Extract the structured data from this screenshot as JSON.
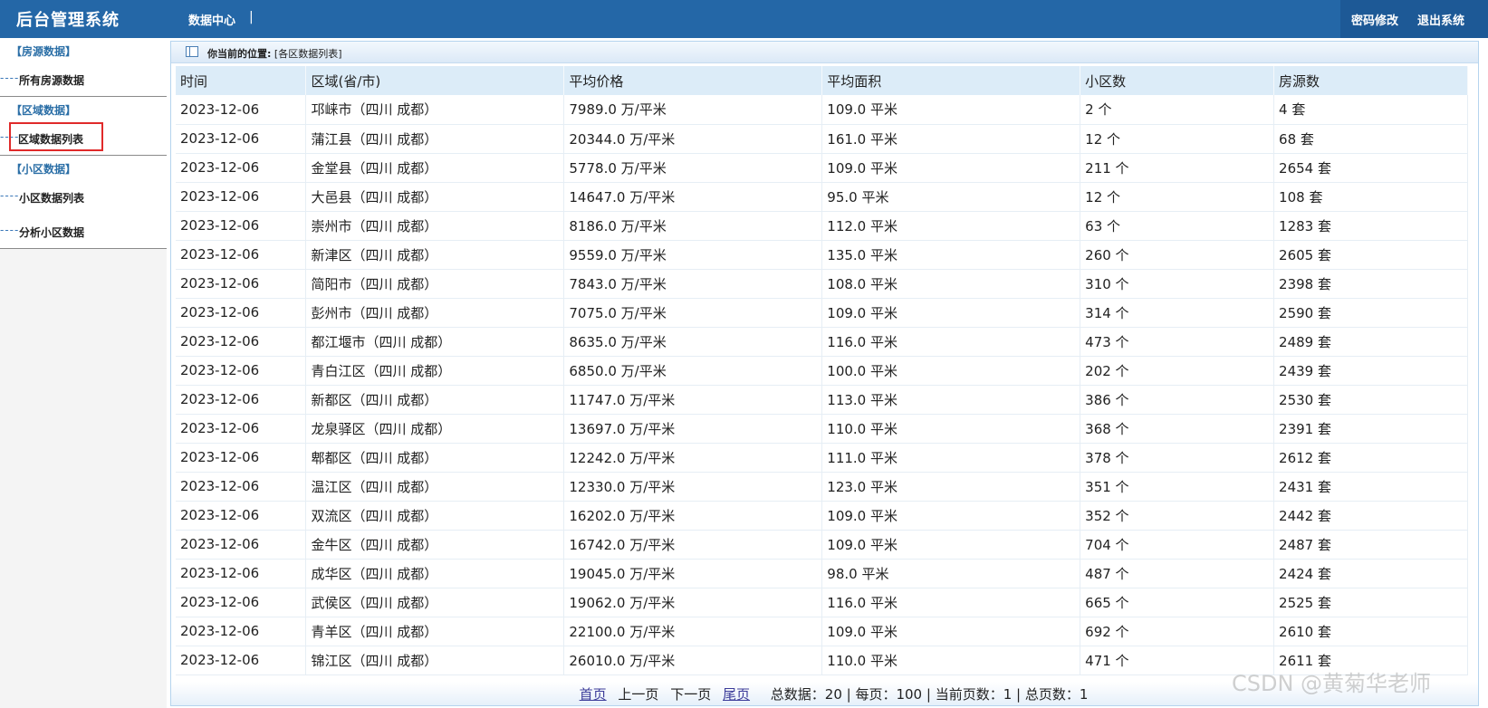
{
  "header": {
    "app_title": "后台管理系统",
    "nav_link": "数据中心",
    "nav_sep": "|",
    "change_password": "密码修改",
    "logout": "退出系统"
  },
  "sidebar": {
    "groups": [
      {
        "title": "【房源数据】",
        "items": [
          {
            "label": "所有房源数据",
            "dash": "----"
          }
        ]
      },
      {
        "title": "【区域数据】",
        "items": [
          {
            "label": "区域数据列表",
            "dash": "----",
            "active": true
          }
        ]
      },
      {
        "title": "【小区数据】",
        "items": [
          {
            "label": "小区数据列表",
            "dash": "----"
          },
          {
            "label": "分析小区数据",
            "dash": "----"
          }
        ]
      }
    ]
  },
  "breadcrumb": {
    "label": "你当前的位置:",
    "value": "[各区数据列表]"
  },
  "table": {
    "headers": [
      "时间",
      "区域(省/市)",
      "平均价格",
      "平均面积",
      "小区数",
      "房源数"
    ],
    "rows": [
      [
        "2023-12-06",
        "邛崃市（四川 成都）",
        "7989.0 万/平米",
        "109.0 平米",
        "2 个",
        "4 套"
      ],
      [
        "2023-12-06",
        "蒲江县（四川 成都）",
        "20344.0 万/平米",
        "161.0 平米",
        "12 个",
        "68 套"
      ],
      [
        "2023-12-06",
        "金堂县（四川 成都）",
        "5778.0 万/平米",
        "109.0 平米",
        "211 个",
        "2654 套"
      ],
      [
        "2023-12-06",
        "大邑县（四川 成都）",
        "14647.0 万/平米",
        "95.0 平米",
        "12 个",
        "108 套"
      ],
      [
        "2023-12-06",
        "崇州市（四川 成都）",
        "8186.0 万/平米",
        "112.0 平米",
        "63 个",
        "1283 套"
      ],
      [
        "2023-12-06",
        "新津区（四川 成都）",
        "9559.0 万/平米",
        "135.0 平米",
        "260 个",
        "2605 套"
      ],
      [
        "2023-12-06",
        "简阳市（四川 成都）",
        "7843.0 万/平米",
        "108.0 平米",
        "310 个",
        "2398 套"
      ],
      [
        "2023-12-06",
        "彭州市（四川 成都）",
        "7075.0 万/平米",
        "109.0 平米",
        "314 个",
        "2590 套"
      ],
      [
        "2023-12-06",
        "都江堰市（四川 成都）",
        "8635.0 万/平米",
        "116.0 平米",
        "473 个",
        "2489 套"
      ],
      [
        "2023-12-06",
        "青白江区（四川 成都）",
        "6850.0 万/平米",
        "100.0 平米",
        "202 个",
        "2439 套"
      ],
      [
        "2023-12-06",
        "新都区（四川 成都）",
        "11747.0 万/平米",
        "113.0 平米",
        "386 个",
        "2530 套"
      ],
      [
        "2023-12-06",
        "龙泉驿区（四川 成都）",
        "13697.0 万/平米",
        "110.0 平米",
        "368 个",
        "2391 套"
      ],
      [
        "2023-12-06",
        "郫都区（四川 成都）",
        "12242.0 万/平米",
        "111.0 平米",
        "378 个",
        "2612 套"
      ],
      [
        "2023-12-06",
        "温江区（四川 成都）",
        "12330.0 万/平米",
        "123.0 平米",
        "351 个",
        "2431 套"
      ],
      [
        "2023-12-06",
        "双流区（四川 成都）",
        "16202.0 万/平米",
        "109.0 平米",
        "352 个",
        "2442 套"
      ],
      [
        "2023-12-06",
        "金牛区（四川 成都）",
        "16742.0 万/平米",
        "109.0 平米",
        "704 个",
        "2487 套"
      ],
      [
        "2023-12-06",
        "成华区（四川 成都）",
        "19045.0 万/平米",
        "98.0 平米",
        "487 个",
        "2424 套"
      ],
      [
        "2023-12-06",
        "武侯区（四川 成都）",
        "19062.0 万/平米",
        "116.0 平米",
        "665 个",
        "2525 套"
      ],
      [
        "2023-12-06",
        "青羊区（四川 成都）",
        "22100.0 万/平米",
        "109.0 平米",
        "692 个",
        "2610 套"
      ],
      [
        "2023-12-06",
        "锦江区（四川 成都）",
        "26010.0 万/平米",
        "110.0 平米",
        "471 个",
        "2611 套"
      ]
    ]
  },
  "pager": {
    "first": "首页",
    "prev": "上一页",
    "next": "下一页",
    "last": "尾页",
    "summary": "总数据：20 | 每页：100 | 当前页数：1 | 总页数：1"
  },
  "watermark": "CSDN @黄菊华老师",
  "colors": {
    "header_bg": "#2467a7",
    "accent": "#2a6ea6",
    "highlight_border": "#e02a2a"
  }
}
